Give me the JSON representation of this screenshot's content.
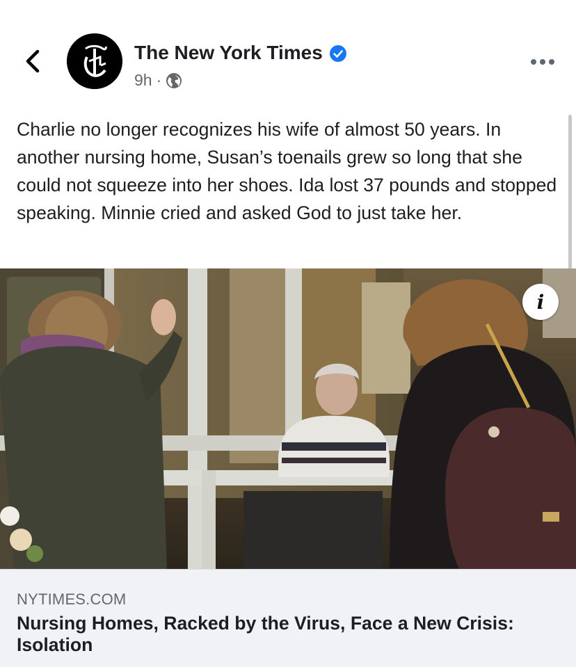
{
  "header": {
    "page_name": "The New York Times",
    "time": "9h",
    "separator": "·",
    "privacy_icon": "globe-icon",
    "back_icon": "chevron-left-icon",
    "more_icon": "more-horizontal-icon",
    "verified_icon": "verified-badge-icon",
    "verified_color": "#1877f2"
  },
  "post": {
    "text": "Charlie no longer recognizes his wife of almost 50 years. In another nursing home, Susan’s toenails grew so long that she could not squeeze into her shoes. Ida lost 37 pounds and stopped speaking. Minnie cried and asked God to just take her."
  },
  "photo": {
    "info_label": "i"
  },
  "link_card": {
    "domain": "NYTIMES.COM",
    "headline": "Nursing Homes, Racked by the Virus, Face a New Crisis: Isolation"
  }
}
